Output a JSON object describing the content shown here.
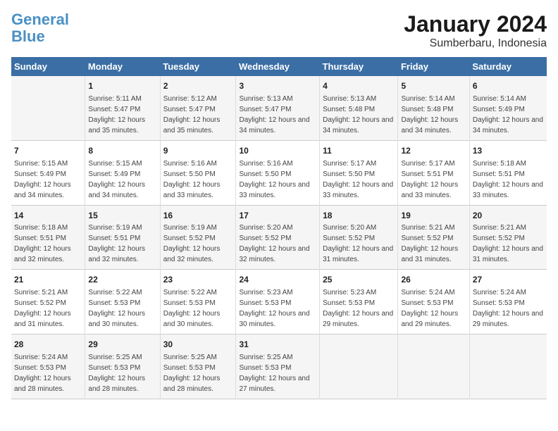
{
  "header": {
    "logo_line1": "General",
    "logo_line2": "Blue",
    "title": "January 2024",
    "subtitle": "Sumberbaru, Indonesia"
  },
  "weekdays": [
    "Sunday",
    "Monday",
    "Tuesday",
    "Wednesday",
    "Thursday",
    "Friday",
    "Saturday"
  ],
  "weeks": [
    [
      {
        "day": "",
        "sunrise": "",
        "sunset": "",
        "daylight": ""
      },
      {
        "day": "1",
        "sunrise": "Sunrise: 5:11 AM",
        "sunset": "Sunset: 5:47 PM",
        "daylight": "Daylight: 12 hours and 35 minutes."
      },
      {
        "day": "2",
        "sunrise": "Sunrise: 5:12 AM",
        "sunset": "Sunset: 5:47 PM",
        "daylight": "Daylight: 12 hours and 35 minutes."
      },
      {
        "day": "3",
        "sunrise": "Sunrise: 5:13 AM",
        "sunset": "Sunset: 5:47 PM",
        "daylight": "Daylight: 12 hours and 34 minutes."
      },
      {
        "day": "4",
        "sunrise": "Sunrise: 5:13 AM",
        "sunset": "Sunset: 5:48 PM",
        "daylight": "Daylight: 12 hours and 34 minutes."
      },
      {
        "day": "5",
        "sunrise": "Sunrise: 5:14 AM",
        "sunset": "Sunset: 5:48 PM",
        "daylight": "Daylight: 12 hours and 34 minutes."
      },
      {
        "day": "6",
        "sunrise": "Sunrise: 5:14 AM",
        "sunset": "Sunset: 5:49 PM",
        "daylight": "Daylight: 12 hours and 34 minutes."
      }
    ],
    [
      {
        "day": "7",
        "sunrise": "Sunrise: 5:15 AM",
        "sunset": "Sunset: 5:49 PM",
        "daylight": "Daylight: 12 hours and 34 minutes."
      },
      {
        "day": "8",
        "sunrise": "Sunrise: 5:15 AM",
        "sunset": "Sunset: 5:49 PM",
        "daylight": "Daylight: 12 hours and 34 minutes."
      },
      {
        "day": "9",
        "sunrise": "Sunrise: 5:16 AM",
        "sunset": "Sunset: 5:50 PM",
        "daylight": "Daylight: 12 hours and 33 minutes."
      },
      {
        "day": "10",
        "sunrise": "Sunrise: 5:16 AM",
        "sunset": "Sunset: 5:50 PM",
        "daylight": "Daylight: 12 hours and 33 minutes."
      },
      {
        "day": "11",
        "sunrise": "Sunrise: 5:17 AM",
        "sunset": "Sunset: 5:50 PM",
        "daylight": "Daylight: 12 hours and 33 minutes."
      },
      {
        "day": "12",
        "sunrise": "Sunrise: 5:17 AM",
        "sunset": "Sunset: 5:51 PM",
        "daylight": "Daylight: 12 hours and 33 minutes."
      },
      {
        "day": "13",
        "sunrise": "Sunrise: 5:18 AM",
        "sunset": "Sunset: 5:51 PM",
        "daylight": "Daylight: 12 hours and 33 minutes."
      }
    ],
    [
      {
        "day": "14",
        "sunrise": "Sunrise: 5:18 AM",
        "sunset": "Sunset: 5:51 PM",
        "daylight": "Daylight: 12 hours and 32 minutes."
      },
      {
        "day": "15",
        "sunrise": "Sunrise: 5:19 AM",
        "sunset": "Sunset: 5:51 PM",
        "daylight": "Daylight: 12 hours and 32 minutes."
      },
      {
        "day": "16",
        "sunrise": "Sunrise: 5:19 AM",
        "sunset": "Sunset: 5:52 PM",
        "daylight": "Daylight: 12 hours and 32 minutes."
      },
      {
        "day": "17",
        "sunrise": "Sunrise: 5:20 AM",
        "sunset": "Sunset: 5:52 PM",
        "daylight": "Daylight: 12 hours and 32 minutes."
      },
      {
        "day": "18",
        "sunrise": "Sunrise: 5:20 AM",
        "sunset": "Sunset: 5:52 PM",
        "daylight": "Daylight: 12 hours and 31 minutes."
      },
      {
        "day": "19",
        "sunrise": "Sunrise: 5:21 AM",
        "sunset": "Sunset: 5:52 PM",
        "daylight": "Daylight: 12 hours and 31 minutes."
      },
      {
        "day": "20",
        "sunrise": "Sunrise: 5:21 AM",
        "sunset": "Sunset: 5:52 PM",
        "daylight": "Daylight: 12 hours and 31 minutes."
      }
    ],
    [
      {
        "day": "21",
        "sunrise": "Sunrise: 5:21 AM",
        "sunset": "Sunset: 5:52 PM",
        "daylight": "Daylight: 12 hours and 31 minutes."
      },
      {
        "day": "22",
        "sunrise": "Sunrise: 5:22 AM",
        "sunset": "Sunset: 5:53 PM",
        "daylight": "Daylight: 12 hours and 30 minutes."
      },
      {
        "day": "23",
        "sunrise": "Sunrise: 5:22 AM",
        "sunset": "Sunset: 5:53 PM",
        "daylight": "Daylight: 12 hours and 30 minutes."
      },
      {
        "day": "24",
        "sunrise": "Sunrise: 5:23 AM",
        "sunset": "Sunset: 5:53 PM",
        "daylight": "Daylight: 12 hours and 30 minutes."
      },
      {
        "day": "25",
        "sunrise": "Sunrise: 5:23 AM",
        "sunset": "Sunset: 5:53 PM",
        "daylight": "Daylight: 12 hours and 29 minutes."
      },
      {
        "day": "26",
        "sunrise": "Sunrise: 5:24 AM",
        "sunset": "Sunset: 5:53 PM",
        "daylight": "Daylight: 12 hours and 29 minutes."
      },
      {
        "day": "27",
        "sunrise": "Sunrise: 5:24 AM",
        "sunset": "Sunset: 5:53 PM",
        "daylight": "Daylight: 12 hours and 29 minutes."
      }
    ],
    [
      {
        "day": "28",
        "sunrise": "Sunrise: 5:24 AM",
        "sunset": "Sunset: 5:53 PM",
        "daylight": "Daylight: 12 hours and 28 minutes."
      },
      {
        "day": "29",
        "sunrise": "Sunrise: 5:25 AM",
        "sunset": "Sunset: 5:53 PM",
        "daylight": "Daylight: 12 hours and 28 minutes."
      },
      {
        "day": "30",
        "sunrise": "Sunrise: 5:25 AM",
        "sunset": "Sunset: 5:53 PM",
        "daylight": "Daylight: 12 hours and 28 minutes."
      },
      {
        "day": "31",
        "sunrise": "Sunrise: 5:25 AM",
        "sunset": "Sunset: 5:53 PM",
        "daylight": "Daylight: 12 hours and 27 minutes."
      },
      {
        "day": "",
        "sunrise": "",
        "sunset": "",
        "daylight": ""
      },
      {
        "day": "",
        "sunrise": "",
        "sunset": "",
        "daylight": ""
      },
      {
        "day": "",
        "sunrise": "",
        "sunset": "",
        "daylight": ""
      }
    ]
  ]
}
